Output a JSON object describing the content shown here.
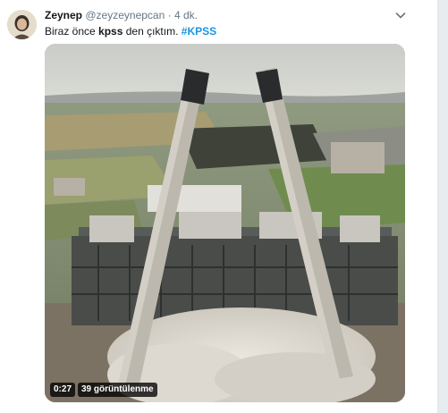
{
  "tweet": {
    "display_name": "Zeynep",
    "handle": "@zeyzeynepcan",
    "separator": "·",
    "time": "4 dk.",
    "text_before": "Biraz önce ",
    "text_bold": "kpss",
    "text_after": " den çıktım.",
    "hashtag": "#KPSS"
  },
  "media": {
    "duration": "0:27",
    "views": "39 görüntülenme"
  },
  "icons": {
    "caret": "chevron-down-icon"
  },
  "colors": {
    "link": "#1b95e0",
    "secondary_text": "#657786"
  }
}
